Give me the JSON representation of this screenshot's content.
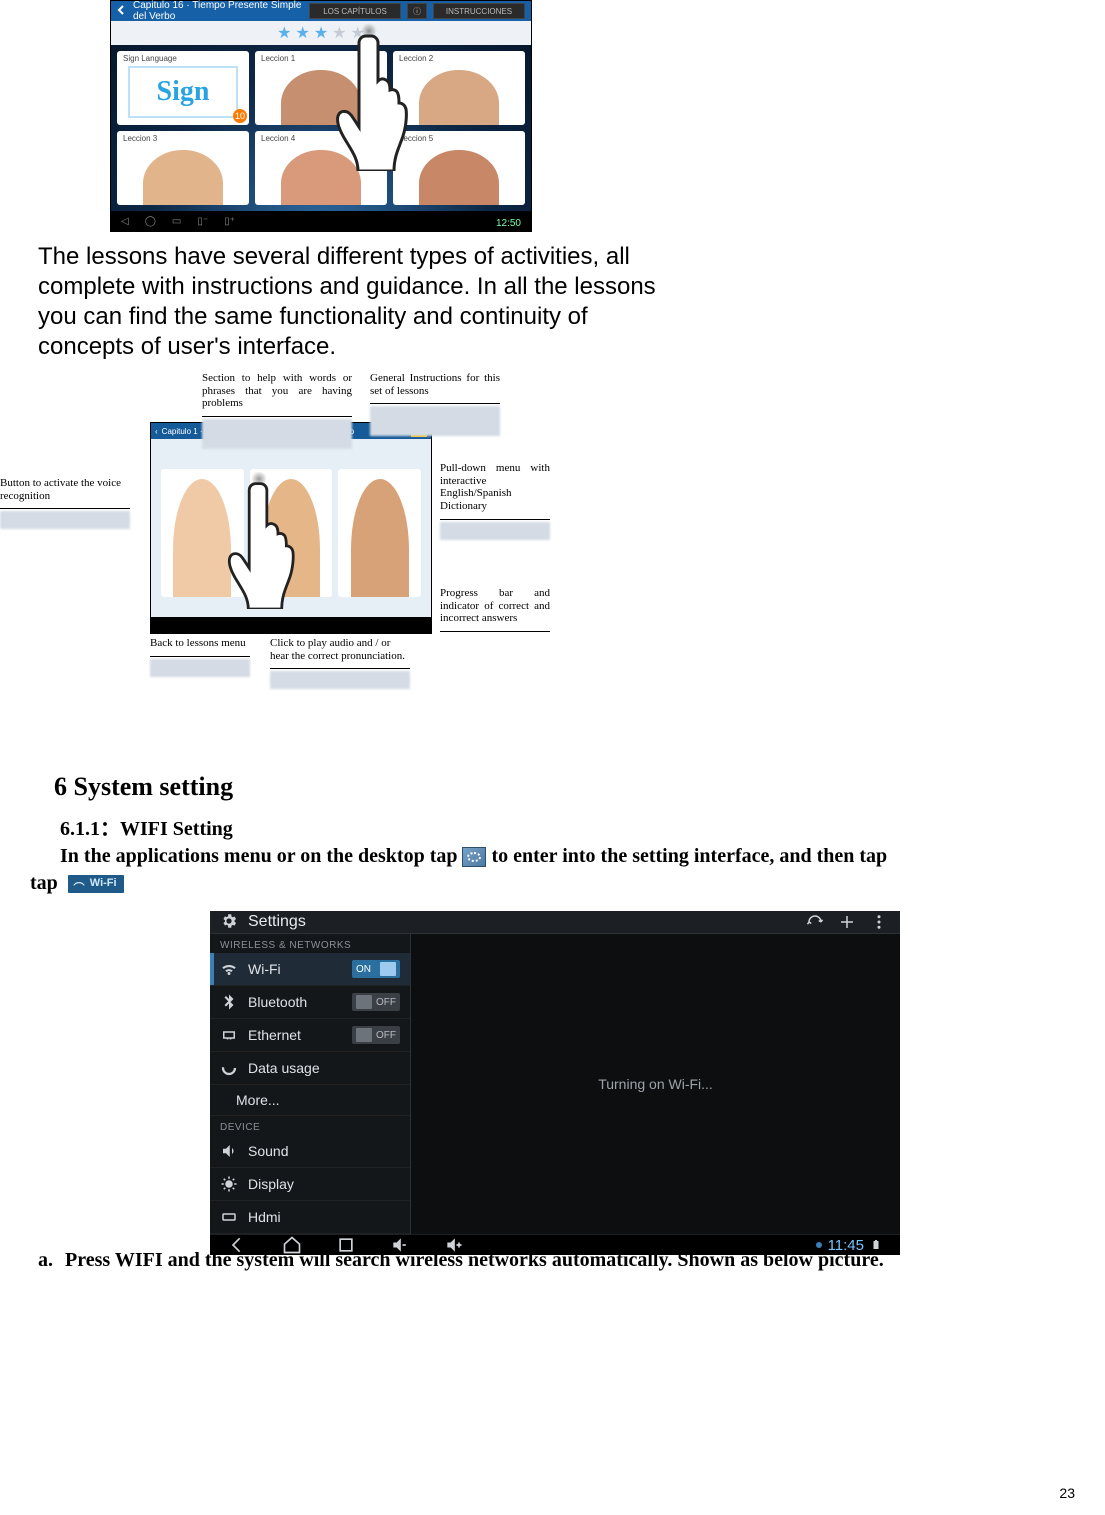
{
  "shot1": {
    "titlebar_text": "Capitulo 16 · Tiempo Presente Simple del Verbo",
    "right_buttons": [
      "LOS CAPÍTULOS",
      "ⓘ",
      "INSTRUCCIONES"
    ],
    "tiles": [
      {
        "label": "Sign Language",
        "variant": "sign"
      },
      {
        "label": "Leccion 1",
        "variant": "person"
      },
      {
        "label": "Leccion 2",
        "variant": "person"
      },
      {
        "label": "Leccion 3",
        "variant": "person"
      },
      {
        "label": "Leccion 4",
        "variant": "person"
      },
      {
        "label": "Leccion 5",
        "variant": "person"
      }
    ],
    "stars_filled": 3,
    "stars_total": 5,
    "clock": "12:50"
  },
  "para1": "The lessons have several different types of activities, all complete with instructions and guidance. In all the lessons you can find the same functionality and continuity of concepts of user's interface.",
  "annotations": {
    "section_help": "Section to help with words or phrases that you are having problems",
    "general_instructions": "General Instructions for this set of lessons",
    "voice_button": "Button to activate the voice recognition",
    "back_menu": "Back to lessons menu",
    "play_audio": "Click to play audio and / or hear the correct pronunciation.",
    "dictionary": "Pull-down menu with interactive English/Spanish Dictionary",
    "progress_bar": "Progress bar and indicator of correct and incorrect answers",
    "faux_text_help": "Sección que le ayudará con las palabras o frases con las que usted está teniendo problemas",
    "faux_text_instr": "Instrucciones generales para este conjunto de lecciones"
  },
  "shot2": {
    "titlebar_text": "Capitulo 1 · Leccion 2 · Instrucciones en el Aeropuerto"
  },
  "section6": {
    "title": "6 System setting",
    "sub_title": "6.1.1：WIFI Setting",
    "body_part1": "In the applications menu or on the desktop tap ",
    "body_part2": " to enter into the setting interface, and then tap ",
    "wifi_btn_label": "Wi-Fi"
  },
  "settings_screenshot": {
    "app_title": "Settings",
    "top_icons": [
      "scan",
      "plus",
      "more"
    ],
    "side_header_1": "WIRELESS & NETWORKS",
    "side_header_2": "DEVICE",
    "items": [
      {
        "icon": "wifi",
        "label": "Wi-Fi",
        "toggle": "ON",
        "selected": true
      },
      {
        "icon": "bluetooth",
        "label": "Bluetooth",
        "toggle": "OFF",
        "selected": false
      },
      {
        "icon": "ethernet",
        "label": "Ethernet",
        "toggle": "OFF",
        "selected": false
      },
      {
        "icon": "data",
        "label": "Data usage",
        "toggle": null,
        "selected": false
      },
      {
        "icon": null,
        "label": "More...",
        "toggle": null,
        "selected": false,
        "indent": true
      }
    ],
    "items2": [
      {
        "icon": "sound",
        "label": "Sound"
      },
      {
        "icon": "display",
        "label": "Display"
      },
      {
        "icon": "hdmi",
        "label": "Hdmi"
      }
    ],
    "main_text": "Turning on Wi-Fi...",
    "clock": "11:45"
  },
  "step_a": {
    "marker": "a.",
    "text": "Press WIFI and the system will search wireless networks automatically. Shown as below picture."
  },
  "page_number": "23"
}
